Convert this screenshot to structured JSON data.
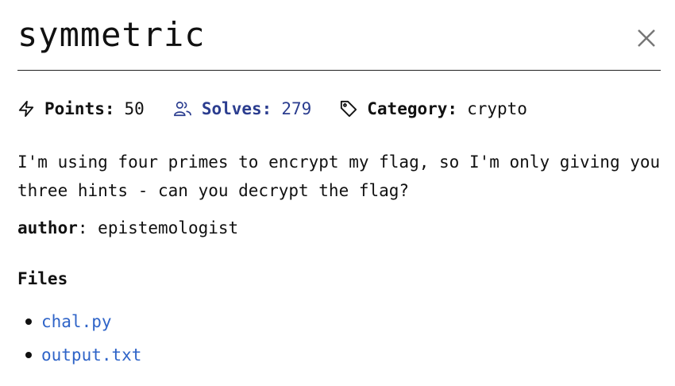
{
  "challenge": {
    "title": "symmetric",
    "description": "I'm using four primes to encrypt my flag, so I'm only giving you three hints - can you decrypt the flag?",
    "author_label": "author",
    "author_separator": ":",
    "author_value": "epistemologist"
  },
  "meta": {
    "points_label": "Points:",
    "points_value": "50",
    "solves_label": "Solves:",
    "solves_value": "279",
    "category_label": "Category:",
    "category_value": "crypto"
  },
  "files": {
    "heading": "Files",
    "items": [
      {
        "name": "chal.py"
      },
      {
        "name": "output.txt"
      }
    ]
  },
  "icons": {
    "points": "lightning-icon",
    "solves": "users-icon",
    "category": "tag-icon",
    "close": "close-icon"
  },
  "colors": {
    "solves": "#2b3d8f",
    "link": "#2f64c8",
    "text": "#111111",
    "close_icon": "#777777"
  }
}
